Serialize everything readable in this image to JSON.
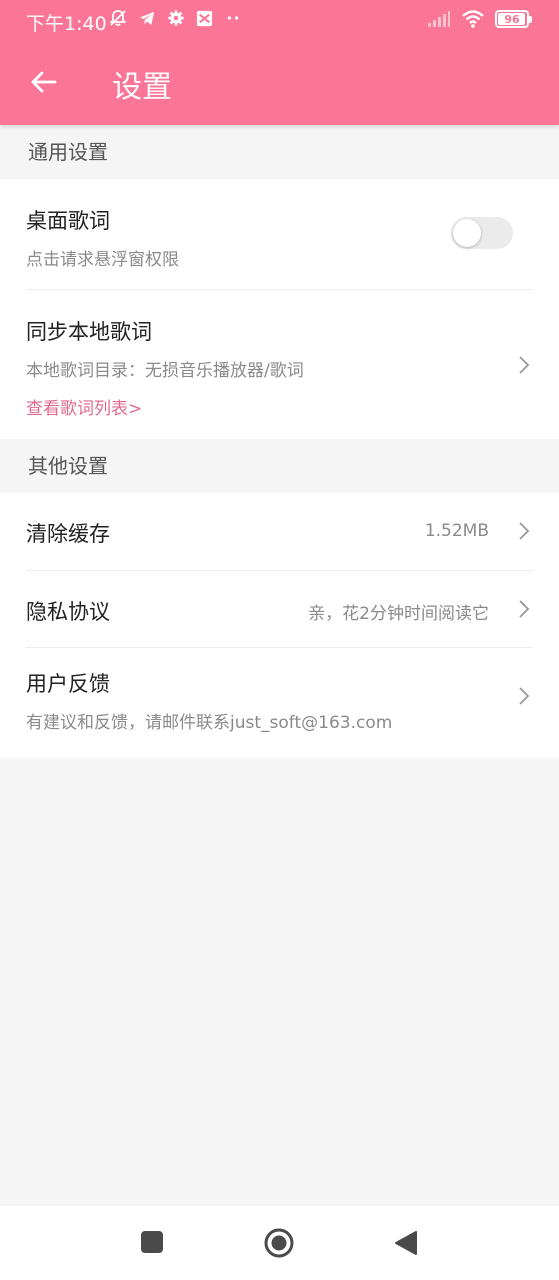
{
  "status_bar": {
    "time": "下午1:40",
    "battery": "96",
    "battery_level": 0.96
  },
  "app_bar": {
    "title": "设置"
  },
  "sections": {
    "general": {
      "header": "通用设置",
      "desktop_lyrics": {
        "title": "桌面歌词",
        "subtitle": "点击请求悬浮窗权限",
        "toggle_on": false
      },
      "sync_lyrics": {
        "title": "同步本地歌词",
        "subtitle": "本地歌词目录：无损音乐播放器/歌词",
        "link": "查看歌词列表>"
      }
    },
    "other": {
      "header": "其他设置",
      "clear_cache": {
        "title": "清除缓存",
        "value": "1.52MB"
      },
      "privacy": {
        "title": "隐私协议",
        "value": "亲，花2分钟时间阅读它"
      },
      "feedback": {
        "title": "用户反馈",
        "subtitle": "有建议和反馈，请邮件联系just_soft@163.com"
      }
    }
  },
  "colors": {
    "accent": "#fb7596",
    "link": "#e06a8e",
    "background": "#f5f5f5"
  },
  "icons": {
    "back": "arrow-left-icon",
    "chevron": "chevron-right-icon",
    "nav_recent": "square-icon",
    "nav_home": "circle-icon",
    "nav_back": "triangle-back-icon"
  }
}
